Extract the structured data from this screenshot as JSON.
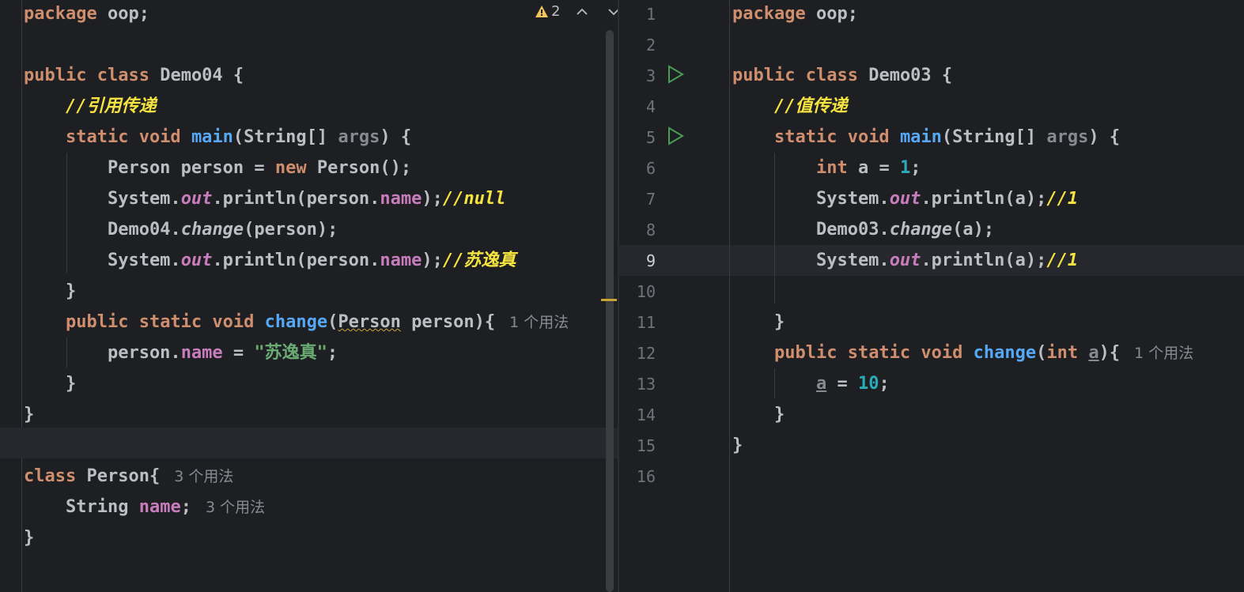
{
  "left_editor": {
    "file_class": "Demo04",
    "inspections": {
      "warning_count": "2"
    },
    "hints": {
      "change_usages": "1 个用法",
      "person_usages": "3 个用法",
      "name_usages": "3 个用法"
    },
    "comments": {
      "ref_pass": "//引用传递",
      "null_result": "//null",
      "name_result": "//苏逸真"
    },
    "string_value": "\"苏逸真\""
  },
  "right_editor": {
    "file_class": "Demo03",
    "line_numbers": [
      "1",
      "2",
      "3",
      "4",
      "5",
      "6",
      "7",
      "8",
      "9",
      "10",
      "11",
      "12",
      "13",
      "14",
      "15",
      "16"
    ],
    "current_line": "9",
    "hints": {
      "change_usages": "1 个用法"
    },
    "comments": {
      "value_pass": "//值传递",
      "result_before": "//1",
      "result_after": "//1"
    },
    "values": {
      "initial": "1",
      "assigned": "10"
    }
  },
  "colors": {
    "background": "#1e1f22",
    "keyword": "#cf8e6d",
    "function": "#56a8f5",
    "field": "#c77dbb",
    "number": "#2aacb8",
    "string": "#6aab73",
    "comment_highlight": "#f5e342",
    "run_icon": "#499c54"
  }
}
